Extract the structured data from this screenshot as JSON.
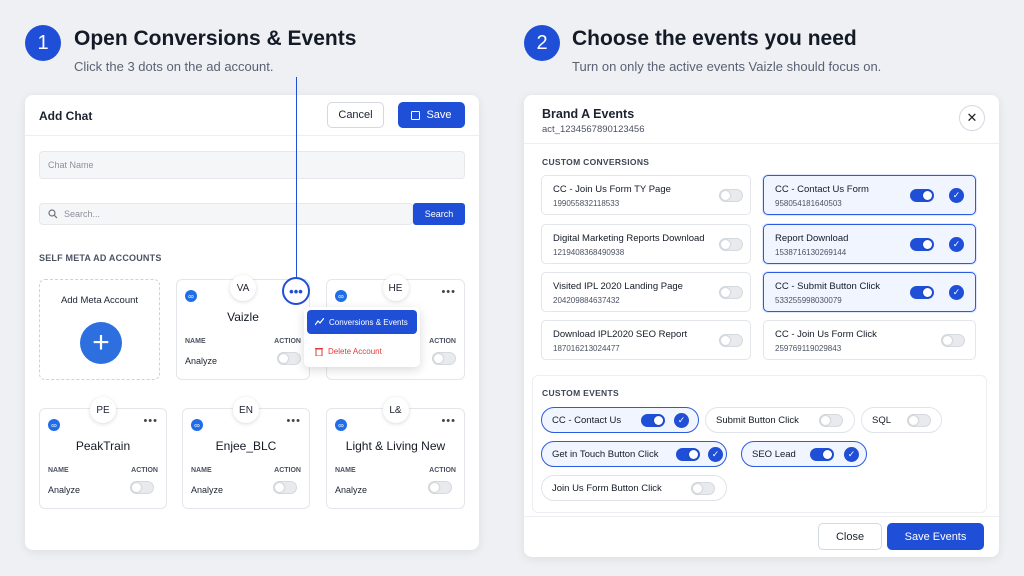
{
  "step1": {
    "num": "1",
    "title": "Open Conversions & Events",
    "subtitle": "Click the 3 dots on the ad account."
  },
  "step2": {
    "num": "2",
    "title": "Choose the events you need",
    "subtitle": "Turn on only the active events Vaizle should focus on."
  },
  "left": {
    "title": "Add Chat",
    "cancel": "Cancel",
    "save": "Save",
    "chat_name_placeholder": "Chat Name",
    "search_placeholder": "Search...",
    "search_btn": "Search",
    "section": "SELF META AD ACCOUNTS",
    "add_account": "Add Meta Account",
    "accounts": [
      {
        "initials": "VA",
        "name": "Vaizle",
        "h_name": "NAME",
        "h_action": "ACTION",
        "value": "Analyze",
        "on": false
      },
      {
        "initials": "HE",
        "name": "",
        "h_name": "NAME",
        "h_action": "ACTION",
        "value": "Analyze",
        "on": false
      },
      {
        "initials": "PE",
        "name": "PeakTrain",
        "h_name": "NAME",
        "h_action": "ACTION",
        "value": "Analyze",
        "on": false
      },
      {
        "initials": "EN",
        "name": "Enjee_BLC",
        "h_name": "NAME",
        "h_action": "ACTION",
        "value": "Analyze",
        "on": false
      },
      {
        "initials": "L&",
        "name": "Light & Living New",
        "h_name": "NAME",
        "h_action": "ACTION",
        "value": "Analyze",
        "on": false
      }
    ],
    "menu": {
      "conversions": "Conversions & Events",
      "delete": "Delete Account"
    }
  },
  "right": {
    "title": "Brand A Events",
    "account_id": "act_1234567890123456",
    "conv_section": "CUSTOM CONVERSIONS",
    "conversions": [
      {
        "name": "CC - Join Us Form TY Page",
        "id": "199055832118533",
        "on": false
      },
      {
        "name": "CC - Contact Us Form",
        "id": "958054181640503",
        "on": true
      },
      {
        "name": "Digital Marketing Reports Download",
        "id": "1219408368490938",
        "on": false
      },
      {
        "name": "Report Download",
        "id": "1538716130269144",
        "on": true
      },
      {
        "name": "Visited IPL 2020 Landing Page",
        "id": "204209884637432",
        "on": false
      },
      {
        "name": "CC - Submit Button Click",
        "id": "533255998030079",
        "on": true
      },
      {
        "name": "Download IPL2020 SEO Report",
        "id": "187016213024477",
        "on": false
      },
      {
        "name": "CC - Join Us Form Click",
        "id": "259769119029843",
        "on": false
      }
    ],
    "events_section": "CUSTOM EVENTS",
    "events": [
      {
        "name": "CC - Contact Us",
        "on": true
      },
      {
        "name": "Submit Button Click",
        "on": false
      },
      {
        "name": "SQL",
        "on": false
      },
      {
        "name": "Get in Touch Button Click",
        "on": true
      },
      {
        "name": "SEO Lead",
        "on": true
      },
      {
        "name": "Join Us Form Button Click",
        "on": false
      }
    ],
    "close": "Close",
    "save_events": "Save Events"
  },
  "colors": {
    "accent": "#1f4fd6",
    "danger": "#e03a3a"
  }
}
